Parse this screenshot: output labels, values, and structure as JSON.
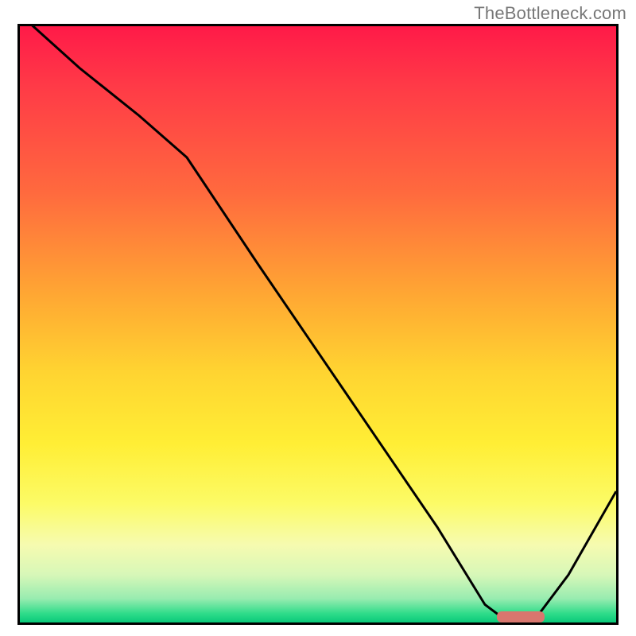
{
  "watermark": "TheBottleneck.com",
  "chart_data": {
    "type": "line",
    "title": "",
    "xlabel": "",
    "ylabel": "",
    "xlim": [
      0,
      100
    ],
    "ylim": [
      0,
      100
    ],
    "x": [
      0,
      10,
      20,
      28,
      40,
      55,
      70,
      78,
      82,
      86,
      92,
      100
    ],
    "values": [
      102,
      93,
      85,
      78,
      60,
      38,
      16,
      3,
      0,
      0,
      8,
      22
    ],
    "gradient_stops": [
      {
        "pct": 0,
        "color": "#ff1a48"
      },
      {
        "pct": 28,
        "color": "#ff6a3e"
      },
      {
        "pct": 58,
        "color": "#ffd431"
      },
      {
        "pct": 80,
        "color": "#fcfb66"
      },
      {
        "pct": 96,
        "color": "#98ecb0"
      },
      {
        "pct": 100,
        "color": "#09c97a"
      }
    ],
    "minimum_marker": {
      "x_start": 80,
      "x_end": 88,
      "y": 0,
      "color": "#d9766e"
    }
  }
}
